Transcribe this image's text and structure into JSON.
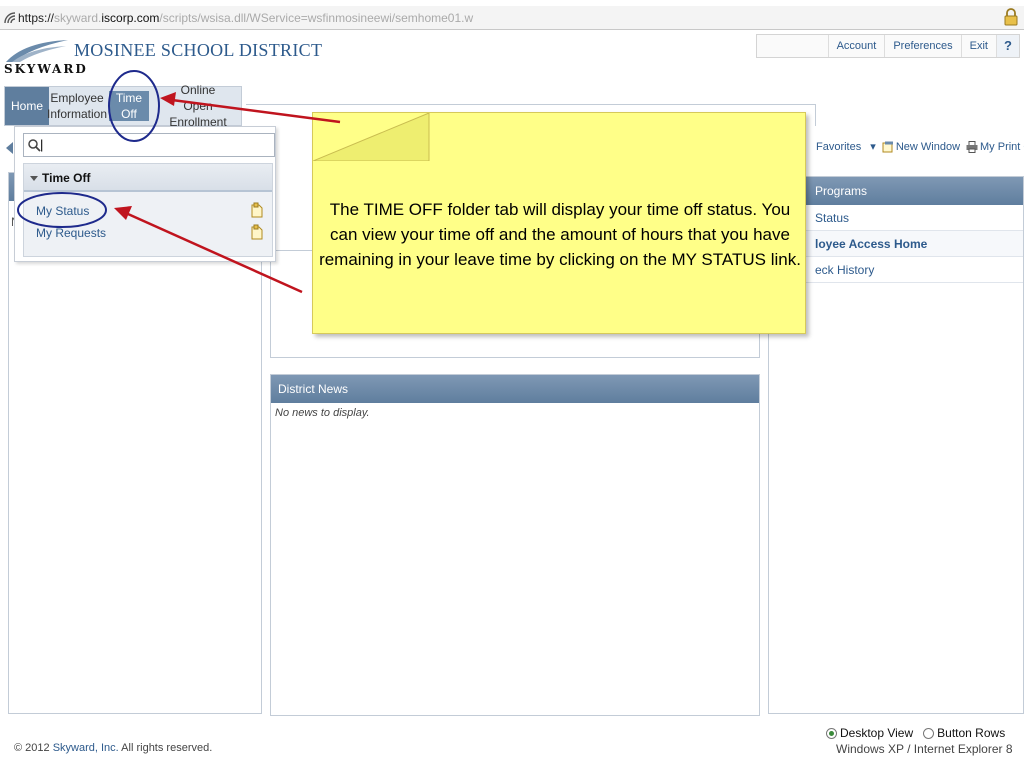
{
  "browser": {
    "url_scheme": "https://",
    "url_pre": "skyward.",
    "url_host": "iscorp.com",
    "url_path": "/scripts/wsisa.dll/WService=wsfinmosineewi/semhome01.w"
  },
  "header": {
    "brand": "SKYWARD",
    "district": "MOSINEE SCHOOL DISTRICT",
    "buttons": {
      "account": "Account",
      "preferences": "Preferences",
      "exit": "Exit",
      "help": "?"
    }
  },
  "nav": {
    "tabs": [
      {
        "label": "Home"
      },
      {
        "line1": "Employee",
        "line2": "Information"
      },
      {
        "line1": "Time",
        "line2": "Off"
      },
      {
        "line1": "Online",
        "line2": "Open Enrollment"
      }
    ]
  },
  "dropdown": {
    "search_value": "|",
    "group_title": "Time Off",
    "items": [
      "My Status",
      "My Requests"
    ]
  },
  "left_panel": {
    "partial_text": "N"
  },
  "district_news": {
    "title": "District News",
    "empty": "No news to display."
  },
  "favbar": {
    "favorites": "Favorites",
    "new_window": "New Window",
    "print_queue": "My Print Queue"
  },
  "right_panel": {
    "title": "Programs",
    "rows": [
      "Status",
      "loyee Access Home",
      "eck History"
    ]
  },
  "callout": {
    "text": "The TIME OFF folder tab will display your time off status.  You can view your time off and the amount of hours that you have remaining in your leave time by clicking on the MY STATUS link."
  },
  "footer": {
    "copyright_pre": "© 2012 ",
    "company": "Skyward, Inc.",
    "copyright_post": " All rights reserved.",
    "view_desktop": "Desktop View",
    "view_buttons": "Button Rows",
    "platform": "Windows XP / Internet Explorer 8"
  },
  "colors": {
    "accent": "#2d5a8c",
    "header_blue": "#5f7e9e",
    "callout": "#ffff88",
    "annotation": "#c0141e",
    "circle": "#1e2a8c"
  }
}
